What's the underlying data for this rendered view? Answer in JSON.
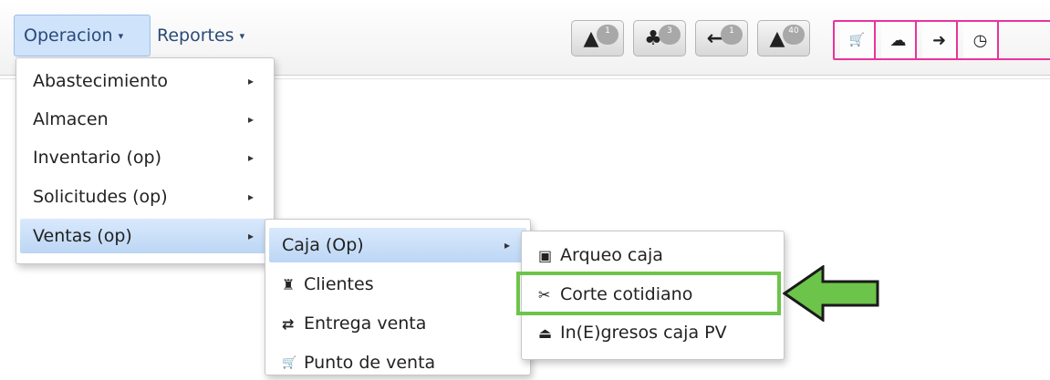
{
  "navbar": {
    "tabs": [
      {
        "label": "Operacion",
        "caret": "▾"
      },
      {
        "label": "Reportes",
        "caret": "▾"
      }
    ],
    "alerts": [
      {
        "icon": "warning-icon",
        "glyph": "▲",
        "count": "1"
      },
      {
        "icon": "users-alert-icon",
        "glyph": "♣",
        "count": "3"
      },
      {
        "icon": "arrow-left-icon",
        "glyph": "←",
        "count": "1"
      },
      {
        "icon": "warning-icon",
        "glyph": "▲",
        "count": "40"
      }
    ],
    "toolbar": [
      {
        "icon": "cart-icon",
        "glyph": "🛒"
      },
      {
        "icon": "cloud-upload-icon",
        "glyph": "☁"
      },
      {
        "icon": "sign-in-icon",
        "glyph": "➜"
      },
      {
        "icon": "clock-icon",
        "glyph": "◷"
      }
    ],
    "toolbar_border_color": "#e8349a"
  },
  "menu_operacion": {
    "items": [
      {
        "label": "Abastecimiento",
        "arrow": "▸"
      },
      {
        "label": "Almacen",
        "arrow": "▸"
      },
      {
        "label": "Inventario (op)",
        "arrow": "▸"
      },
      {
        "label": "Solicitudes (op)",
        "arrow": "▸"
      },
      {
        "label": "Ventas (op)",
        "arrow": "▸"
      }
    ]
  },
  "menu_ventas": {
    "items": [
      {
        "label": "Caja (Op)",
        "arrow": "▸",
        "icon": ""
      },
      {
        "label": "Clientes",
        "icon": "user-icon",
        "glyph": "♜"
      },
      {
        "label": "Entrega venta",
        "icon": "exchange-icon",
        "glyph": "⇄"
      },
      {
        "label": "Punto de venta",
        "icon": "cart-icon",
        "glyph": "🛒"
      }
    ]
  },
  "menu_caja": {
    "items": [
      {
        "label": "Arqueo caja",
        "icon": "money-icon",
        "glyph": "▣"
      },
      {
        "label": "Corte cotidiano",
        "icon": "scissors-icon",
        "glyph": "✂"
      },
      {
        "label": "In(E)gresos caja PV",
        "icon": "inbox-icon",
        "glyph": "⏏"
      }
    ]
  },
  "annotation": {
    "highlight_color": "#6cc44a"
  }
}
